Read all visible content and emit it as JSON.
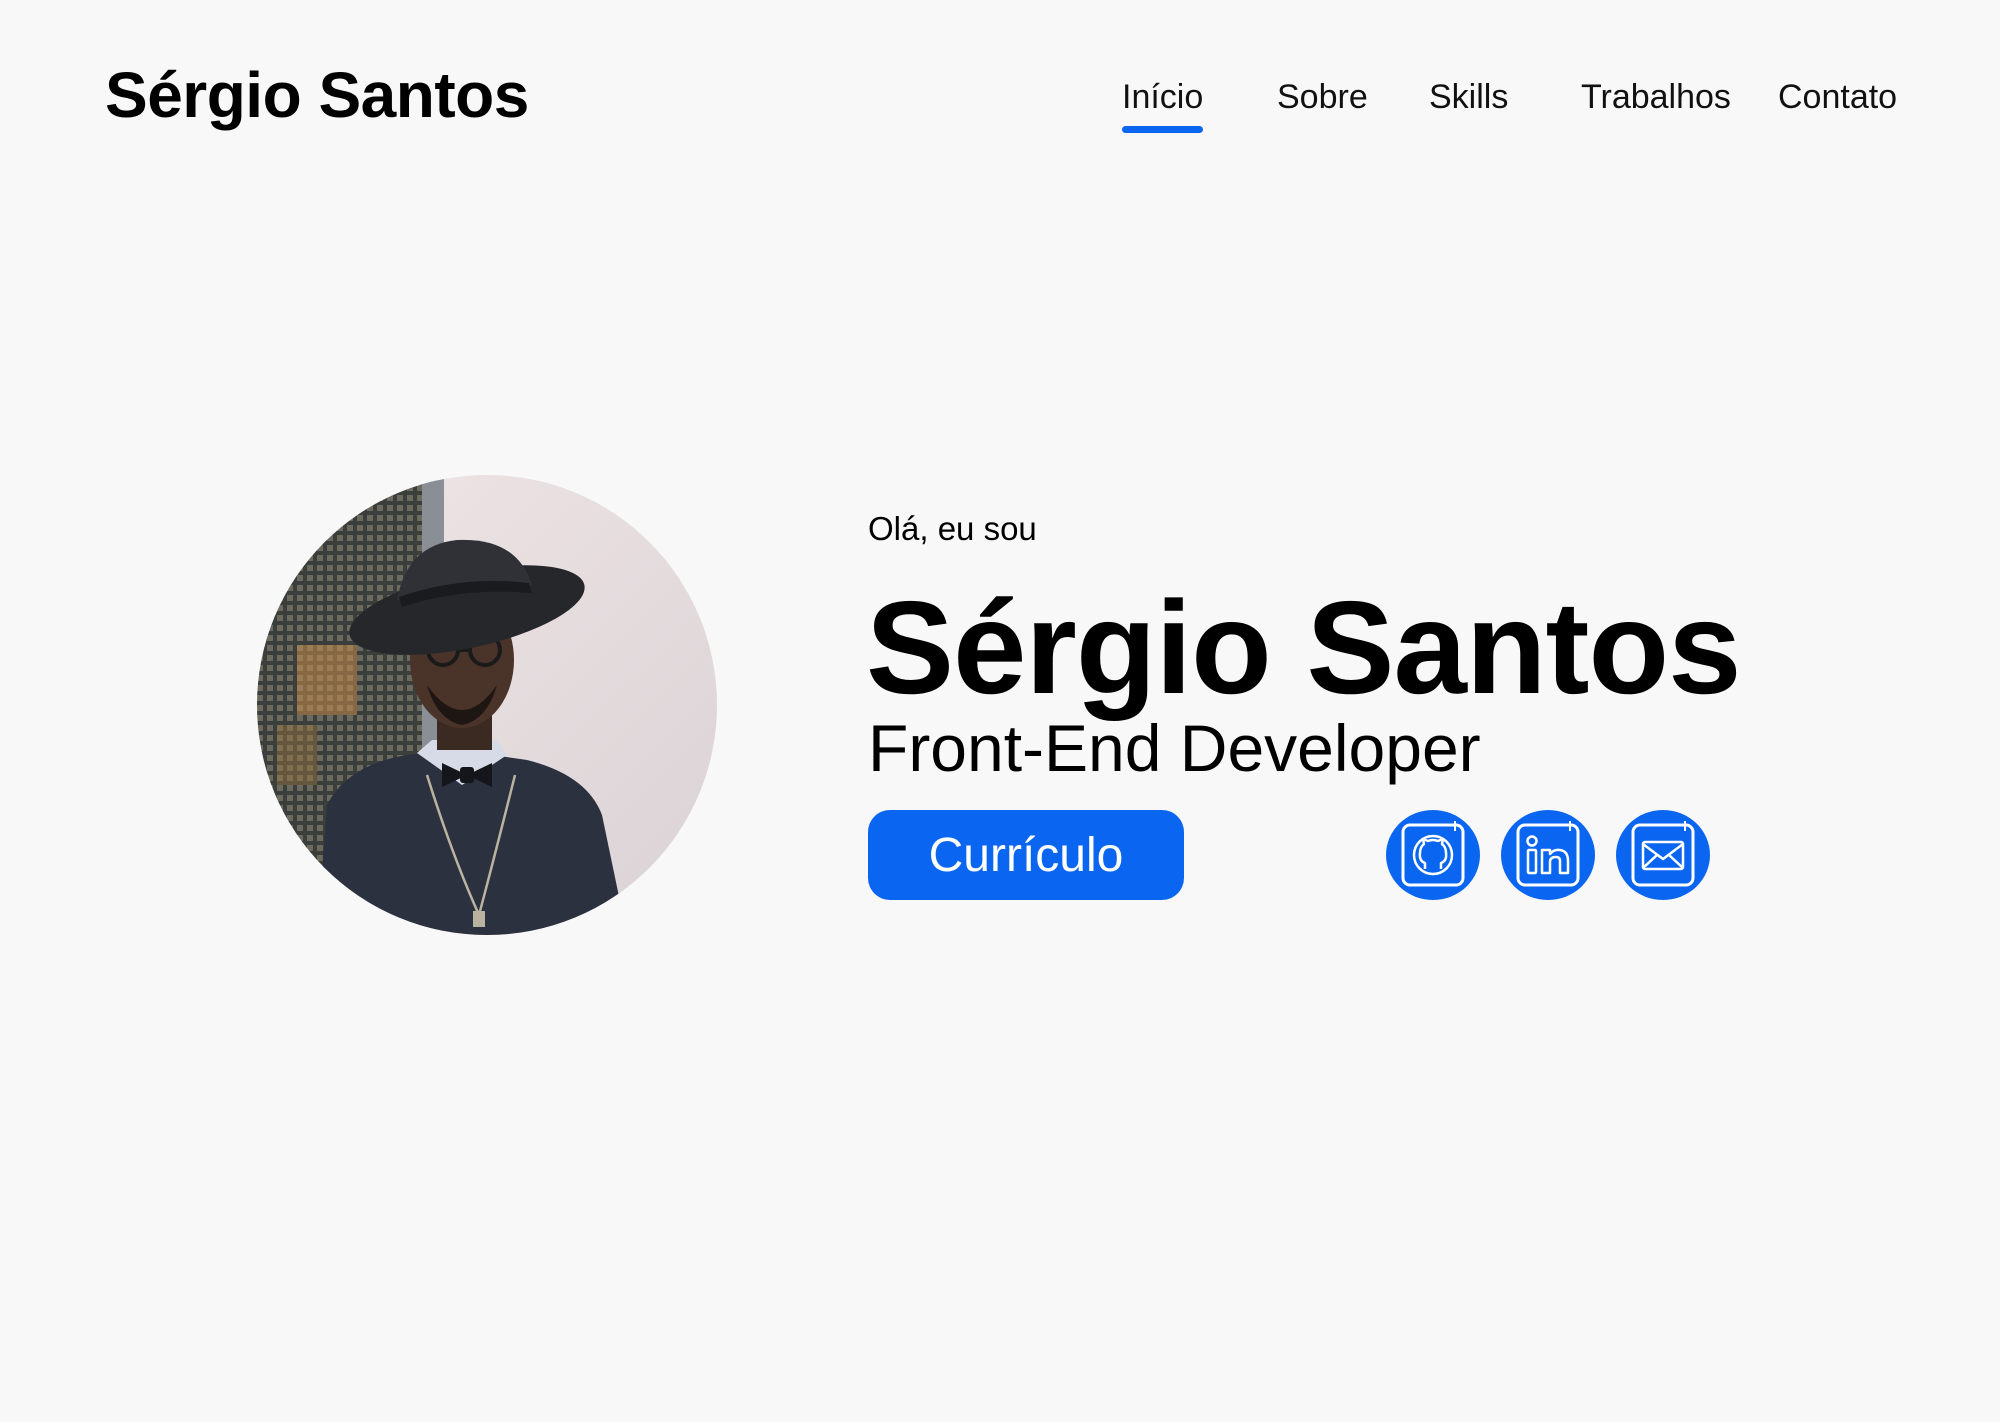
{
  "header": {
    "logo": "Sérgio Santos",
    "nav": [
      {
        "label": "Início",
        "active": true
      },
      {
        "label": "Sobre",
        "active": false
      },
      {
        "label": "Skills",
        "active": false
      },
      {
        "label": "Trabalhos",
        "active": false
      },
      {
        "label": "Contato",
        "active": false
      }
    ]
  },
  "hero": {
    "greeting": "Olá, eu sou",
    "name": "Sérgio Santos",
    "role": "Front-End Developer",
    "cv_button": "Currículo",
    "social": [
      {
        "icon": "github-icon"
      },
      {
        "icon": "linkedin-icon"
      },
      {
        "icon": "email-icon"
      }
    ]
  },
  "colors": {
    "accent": "#0a66f0",
    "background": "#f8f8f8",
    "text": "#000000"
  }
}
